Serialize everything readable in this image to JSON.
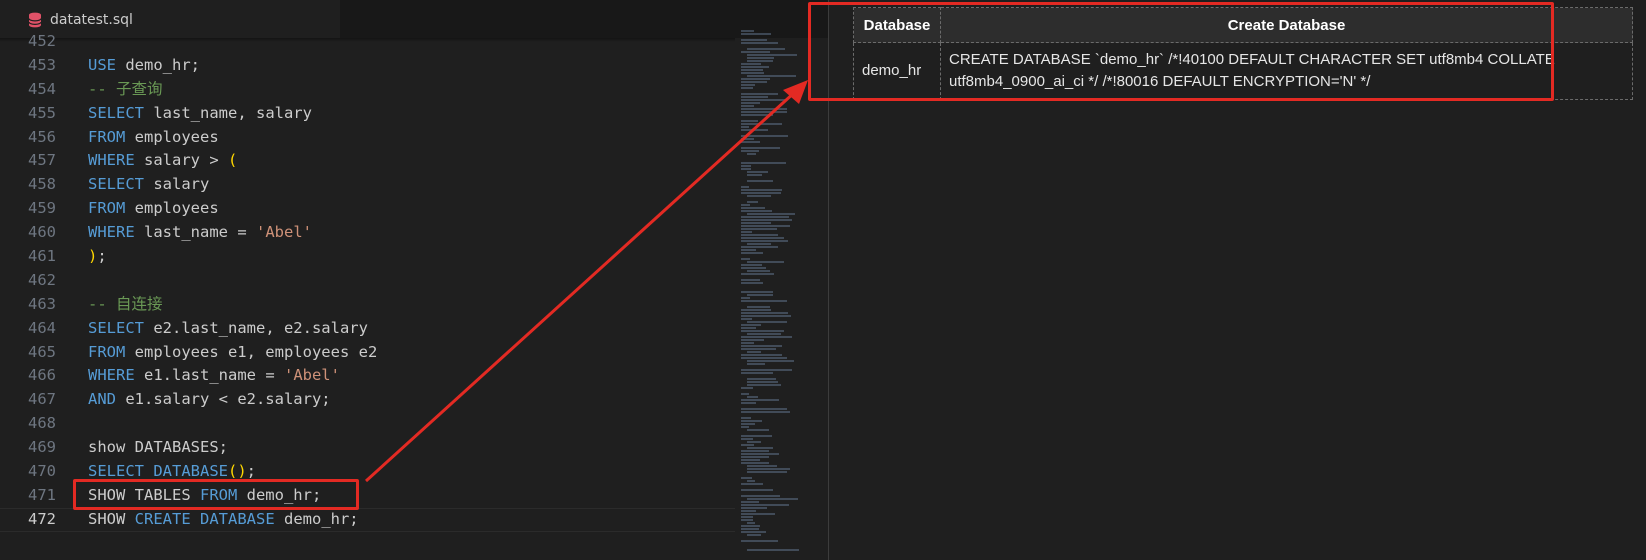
{
  "tab": {
    "filename": "datatest.sql"
  },
  "code_lines": [
    {
      "num": "452",
      "tokens": []
    },
    {
      "num": "453",
      "tokens": [
        [
          "kw",
          "USE"
        ],
        [
          "t",
          " demo_hr;"
        ]
      ]
    },
    {
      "num": "454",
      "tokens": [
        [
          "cmt",
          "-- 子查询"
        ]
      ]
    },
    {
      "num": "455",
      "tokens": [
        [
          "kw",
          "SELECT"
        ],
        [
          "t",
          " last_name, salary"
        ]
      ]
    },
    {
      "num": "456",
      "tokens": [
        [
          "kw",
          "FROM"
        ],
        [
          "t",
          " employees"
        ]
      ]
    },
    {
      "num": "457",
      "tokens": [
        [
          "kw",
          "WHERE"
        ],
        [
          "t",
          " salary > "
        ],
        [
          "punc",
          "("
        ]
      ]
    },
    {
      "num": "458",
      "tokens": [
        [
          "kw",
          "SELECT"
        ],
        [
          "t",
          " salary"
        ]
      ]
    },
    {
      "num": "459",
      "tokens": [
        [
          "kw",
          "FROM"
        ],
        [
          "t",
          " employees"
        ]
      ]
    },
    {
      "num": "460",
      "tokens": [
        [
          "kw",
          "WHERE"
        ],
        [
          "t",
          " last_name = "
        ],
        [
          "str",
          "'Abel'"
        ]
      ]
    },
    {
      "num": "461",
      "tokens": [
        [
          "punc",
          ")"
        ],
        [
          "t",
          ";"
        ]
      ]
    },
    {
      "num": "462",
      "tokens": []
    },
    {
      "num": "463",
      "tokens": [
        [
          "cmt",
          "-- 自连接"
        ]
      ]
    },
    {
      "num": "464",
      "tokens": [
        [
          "kw",
          "SELECT"
        ],
        [
          "t",
          " e2.last_name, e2.salary"
        ]
      ]
    },
    {
      "num": "465",
      "tokens": [
        [
          "kw",
          "FROM"
        ],
        [
          "t",
          " employees e1, employees e2"
        ]
      ]
    },
    {
      "num": "466",
      "tokens": [
        [
          "kw",
          "WHERE"
        ],
        [
          "t",
          " e1.last_name = "
        ],
        [
          "str",
          "'Abel'"
        ]
      ]
    },
    {
      "num": "467",
      "tokens": [
        [
          "kw",
          "AND"
        ],
        [
          "t",
          " e1.salary < e2.salary;"
        ]
      ]
    },
    {
      "num": "468",
      "tokens": []
    },
    {
      "num": "469",
      "tokens": [
        [
          "t",
          "show DATABASES;"
        ]
      ]
    },
    {
      "num": "470",
      "tokens": [
        [
          "kw",
          "SELECT"
        ],
        [
          "t",
          " "
        ],
        [
          "kw",
          "DATABASE"
        ],
        [
          "punc",
          "()"
        ],
        [
          "t",
          ";"
        ]
      ]
    },
    {
      "num": "471",
      "tokens": [
        [
          "t",
          "SHOW TABLES "
        ],
        [
          "kw",
          "FROM"
        ],
        [
          "t",
          " demo_hr;"
        ]
      ]
    },
    {
      "num": "472",
      "tokens": [
        [
          "t",
          "SHOW "
        ],
        [
          "kw",
          "CREATE DATABASE"
        ],
        [
          "t",
          " demo_hr;"
        ]
      ],
      "current": true
    }
  ],
  "result": {
    "headers": [
      "Database",
      "Create Database"
    ],
    "rows": [
      [
        "demo_hr",
        "CREATE DATABASE `demo_hr` /*!40100 DEFAULT CHARACTER SET utf8mb4 COLLATE utf8mb4_0900_ai_ci */ /*!80016 DEFAULT ENCRYPTION='N' */"
      ]
    ]
  },
  "colors": {
    "keyword": "#569cd6",
    "string": "#ce9178",
    "comment": "#6a9955",
    "highlight": "#e32a23"
  }
}
